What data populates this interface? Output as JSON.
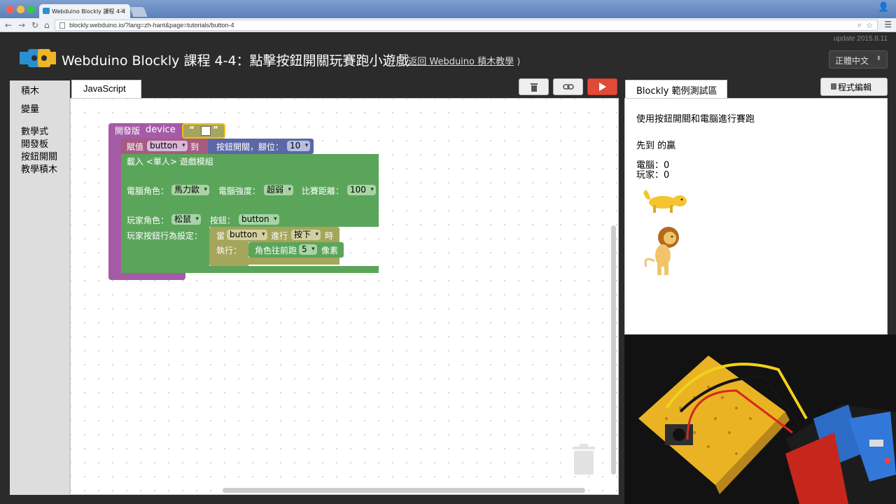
{
  "browser": {
    "tab_title": "Webduino Blockly 課程 4-4",
    "url": "blockly.webduino.io/?lang=zh-hant&page=tutorials/button-4"
  },
  "header": {
    "title": "Webduino Blockly 課程 4-4：點擊按鈕開關玩賽跑小遊戲",
    "back_prefix": "( ",
    "back_link": "返回 Webduino 積木教學",
    "back_suffix": " )",
    "update": "update 2015.8.11",
    "language": "正體中文"
  },
  "toolbox": {
    "items": [
      "積木",
      "變量",
      "數學式",
      "開發板",
      "按鈕開關",
      "教學積木"
    ]
  },
  "workspace": {
    "tab_label": "JavaScript"
  },
  "blocks": {
    "board_label": "開發版",
    "device_label": "device",
    "quote_open": "“",
    "quote_close": "”",
    "device_value": "",
    "assign_label": "賦值",
    "assign_var": "button",
    "to_label": "到",
    "button_pin_label": "按鈕開關，腳位：",
    "button_pin": "10",
    "load_label": "載入 <單人> 遊戲模組",
    "computer_role_label": "電腦角色：",
    "computer_role": "馬力歐",
    "computer_strength_label": "電腦強度：",
    "computer_strength": "超弱",
    "distance_label": "比賽距離：",
    "distance": "100",
    "player_role_label": "玩家角色：",
    "player_role": "松鼠",
    "button_label": "按鈕：",
    "button_value": "button",
    "player_action_label": "玩家按鈕行為設定：",
    "when_label": "當",
    "when_button": "button",
    "do_label": "進行",
    "press_value": "按下",
    "time_label": "時",
    "exec_label": "執行：",
    "move_label": "角色往前跑",
    "move_value": "5",
    "pixels_label": "像素"
  },
  "right_panel": {
    "tab_label": "Blockly 範例測試區",
    "edit_button": "程式編輯",
    "intro": "使用按鈕開關和電腦進行賽跑",
    "winner_text": "先到 的贏",
    "computer_score": "電腦：0",
    "player_score": "玩家：0"
  },
  "colors": {
    "purple_block": "#a55ba6",
    "red_block": "#a65b80",
    "blue_block": "#5b67a6",
    "green_block": "#5ba55b",
    "olive_block": "#a5a55b",
    "run_button": "#e04a37"
  }
}
